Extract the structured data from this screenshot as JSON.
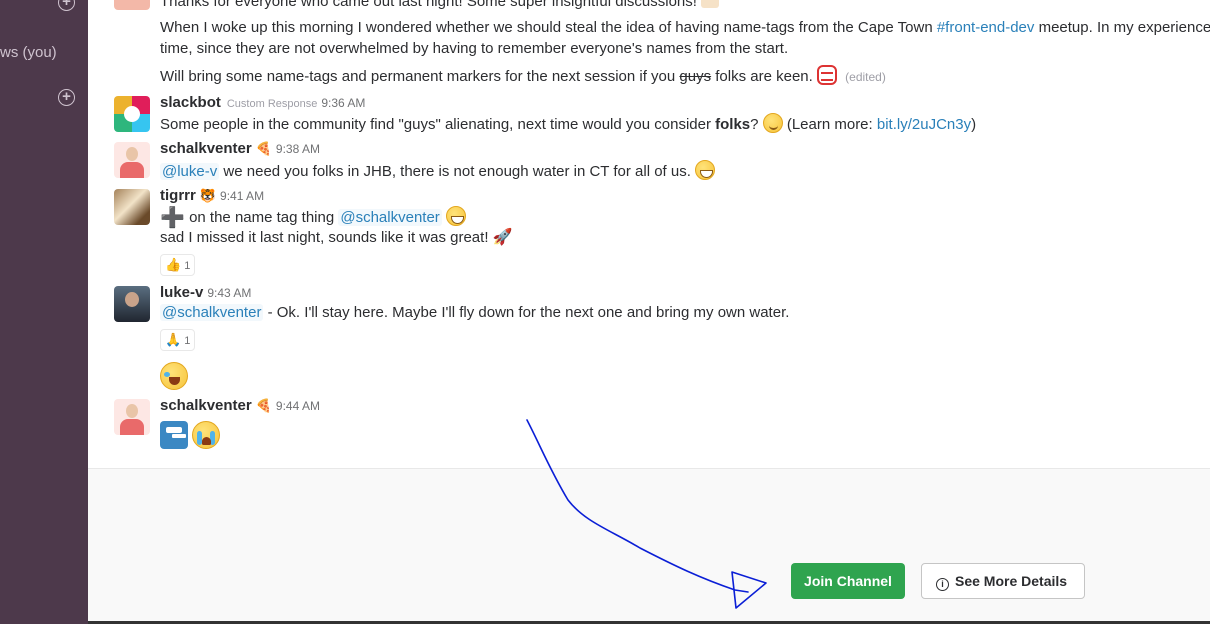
{
  "sidebar": {
    "partial_text": "ws (you)"
  },
  "messages": {
    "top": {
      "line1": "Thanks for everyone who came out last night! Some super insightful discussions!",
      "line2a": "When I woke up this morning I wondered whether we should steal the idea of having name-tags from the Cape Town ",
      "line2_link": "#front-end-dev",
      "line2b": " meetup. In my experience",
      "line3": "time, since they are not overwhelmed by having to remember everyone's names from the start.",
      "line4a": "Will bring some name-tags and permanent markers for the next session if you ",
      "line4_strike": "guys",
      "line4b": " folks are keen.",
      "edited": "(edited)"
    },
    "slackbot": {
      "name": "slackbot",
      "tag": "Custom Response",
      "time": "9:36 AM",
      "text_a": "Some people in the community find \"guys\" alienating, next time would you consider ",
      "text_bold": "folks",
      "text_b": "? ",
      "text_c": " (Learn more: ",
      "link": "bit.ly/2uJCn3y",
      "text_d": ")"
    },
    "schalk1": {
      "name": "schalkventer",
      "time": "9:38 AM",
      "mention": "@luke-v",
      "text": " we need you folks in JHB, there is not enough water in CT for all of us."
    },
    "tigrrr": {
      "name": "tigrrr",
      "time": "9:41 AM",
      "line1": " on the name tag thing ",
      "mention": "@schalkventer",
      "line2": "sad I missed it last night, sounds like it was great!",
      "reaction_count": "1"
    },
    "lukev": {
      "name": "luke-v",
      "time": "9:43 AM",
      "mention": "@schalkventer",
      "text": " - Ok. I'll stay here. Maybe I'll fly down for the next one and bring my own water.",
      "reaction_count": "1"
    },
    "schalk2": {
      "name": "schalkventer",
      "time": "9:44 AM"
    }
  },
  "footer": {
    "join_label": "Join Channel",
    "details_label": "See More Details"
  },
  "icons": [
    "add-circle-icon",
    "smile-emoji",
    "grin-emoji",
    "devil-emoji",
    "pizza-icon",
    "tiger-icon",
    "rocket-emoji",
    "thumbs-up-icon",
    "pray-icon",
    "laugh-emoji",
    "faucet-emoji",
    "cry-emoji",
    "info-icon"
  ],
  "colors": {
    "sidebar_bg": "#4d394b",
    "join_button": "#2fa44f",
    "link": "#2a80b9",
    "annotation_ink": "#0b1fd6"
  }
}
